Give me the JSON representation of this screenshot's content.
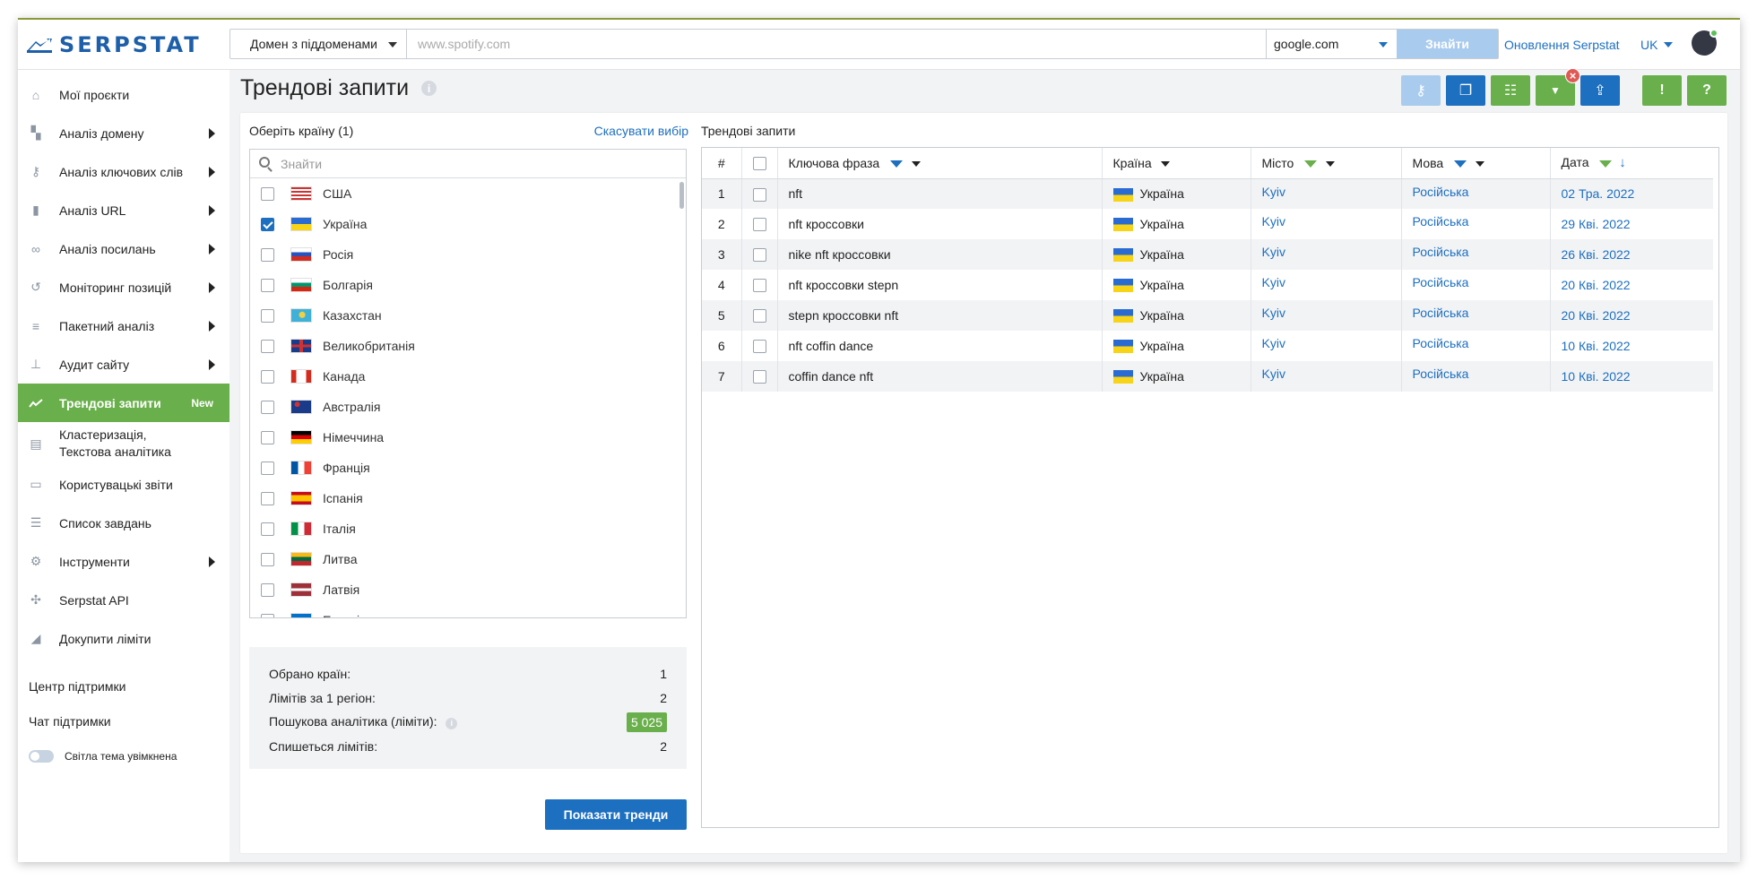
{
  "brand": {
    "name": "SERPSTAT",
    "color": "#1d5fa8"
  },
  "search": {
    "scope_label": "Домен з піддоменами",
    "placeholder": "www.spotify.com",
    "engine": "google.com",
    "find_label": "Знайти"
  },
  "top": {
    "updates_label": "Оновлення Serpstat",
    "lang": "UK"
  },
  "sidebar": {
    "items": [
      {
        "label": "Мої проєкти",
        "icon": "home-icon"
      },
      {
        "label": "Аналіз домену",
        "icon": "domain-analysis-icon"
      },
      {
        "label": "Аналіз ключових слів",
        "icon": "key-icon"
      },
      {
        "label": "Аналіз URL",
        "icon": "bar-chart-icon"
      },
      {
        "label": "Аналіз посилань",
        "icon": "link-icon"
      },
      {
        "label": "Моніторинг позицій",
        "icon": "history-icon"
      },
      {
        "label": "Пакетний аналіз",
        "icon": "database-icon"
      },
      {
        "label": "Аудит сайту",
        "icon": "sitemap-icon"
      },
      {
        "label": "Трендові запити",
        "icon": "trend-icon",
        "badge": "New"
      },
      {
        "label": "Кластеризація,",
        "label2": "Текстова аналітика",
        "icon": "cluster-icon"
      },
      {
        "label": "Користувацькі звіти",
        "icon": "report-icon"
      },
      {
        "label": "Список завдань",
        "icon": "list-icon"
      },
      {
        "label": "Інструменти",
        "icon": "gear-icon"
      },
      {
        "label": "Serpstat API",
        "icon": "api-icon"
      },
      {
        "label": "Докупити ліміти",
        "icon": "limits-icon"
      }
    ],
    "support_center": "Центр підтримки",
    "support_chat": "Чат підтримки",
    "theme_label": "Світла тема увімкнена"
  },
  "page": {
    "title": "Трендові запити"
  },
  "countries": {
    "header": "Оберіть країну (1)",
    "cancel": "Скасувати вибір",
    "search_placeholder": "Знайти",
    "list": [
      {
        "name": "США",
        "checked": false,
        "flag": "us"
      },
      {
        "name": "Україна",
        "checked": true,
        "flag": "ua"
      },
      {
        "name": "Росія",
        "checked": false,
        "flag": "ru"
      },
      {
        "name": "Болгарія",
        "checked": false,
        "flag": "bg"
      },
      {
        "name": "Казахстан",
        "checked": false,
        "flag": "kz"
      },
      {
        "name": "Великобританія",
        "checked": false,
        "flag": "gb"
      },
      {
        "name": "Канада",
        "checked": false,
        "flag": "ca"
      },
      {
        "name": "Австралія",
        "checked": false,
        "flag": "au"
      },
      {
        "name": "Німеччина",
        "checked": false,
        "flag": "de"
      },
      {
        "name": "Франція",
        "checked": false,
        "flag": "fr"
      },
      {
        "name": "Іспанія",
        "checked": false,
        "flag": "es"
      },
      {
        "name": "Італія",
        "checked": false,
        "flag": "it"
      },
      {
        "name": "Литва",
        "checked": false,
        "flag": "lt"
      },
      {
        "name": "Латвія",
        "checked": false,
        "flag": "lv"
      },
      {
        "name": "Естонія",
        "checked": false,
        "flag": "ee"
      }
    ]
  },
  "summary": {
    "selected_label": "Обрано країн:",
    "selected_value": "1",
    "per_region_label": "Лімітів за 1 регіон:",
    "per_region_value": "2",
    "analytics_label": "Пошукова аналітика (ліміти):",
    "analytics_value": "5 025",
    "charge_label": "Спишеться лімітів:",
    "charge_value": "2"
  },
  "show_button": "Показати тренди",
  "table": {
    "label": "Трендові запити",
    "headers": {
      "num": "#",
      "phrase": "Ключова фраза",
      "country": "Країна",
      "city": "Місто",
      "language": "Мова",
      "date": "Дата"
    },
    "rows": [
      {
        "n": "1",
        "phrase": "nft",
        "country": "Україна",
        "city": "Kyiv",
        "language": "Російська",
        "date": "02 Тра. 2022"
      },
      {
        "n": "2",
        "phrase": "nft кроссовки",
        "country": "Україна",
        "city": "Kyiv",
        "language": "Російська",
        "date": "29 Кві. 2022"
      },
      {
        "n": "3",
        "phrase": "nike nft кроссовки",
        "country": "Україна",
        "city": "Kyiv",
        "language": "Російська",
        "date": "26 Кві. 2022"
      },
      {
        "n": "4",
        "phrase": "nft кроссовки stepn",
        "country": "Україна",
        "city": "Kyiv",
        "language": "Російська",
        "date": "20 Кві. 2022"
      },
      {
        "n": "5",
        "phrase": "stepn кроссовки nft",
        "country": "Україна",
        "city": "Kyiv",
        "language": "Російська",
        "date": "20 Кві. 2022"
      },
      {
        "n": "6",
        "phrase": "nft coffin dance",
        "country": "Україна",
        "city": "Kyiv",
        "language": "Російська",
        "date": "10 Кві. 2022"
      },
      {
        "n": "7",
        "phrase": "coffin dance nft",
        "country": "Україна",
        "city": "Kyiv",
        "language": "Російська",
        "date": "10 Кві. 2022"
      }
    ]
  },
  "toolbar": {
    "buttons": [
      {
        "name": "key-icon",
        "color": "#a9cbee",
        "glyph": "⚷"
      },
      {
        "name": "copy-icon",
        "color": "#1d6fc0",
        "glyph": "❐"
      },
      {
        "name": "columns-icon",
        "color": "#69af4b",
        "glyph": "☷"
      },
      {
        "name": "filter-icon",
        "color": "#69af4b",
        "glyph": "▼"
      },
      {
        "name": "export-icon",
        "color": "#1d6fc0",
        "glyph": "⇪"
      },
      {
        "name": "feedback-icon",
        "color": "#69af4b",
        "glyph": "!"
      },
      {
        "name": "help-icon",
        "color": "#69af4b",
        "glyph": "?"
      }
    ]
  }
}
